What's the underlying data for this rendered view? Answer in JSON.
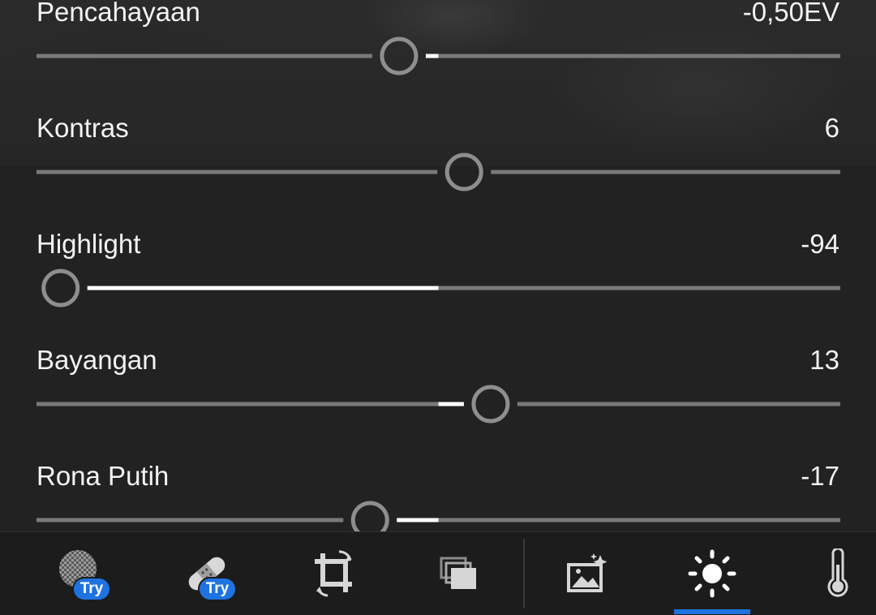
{
  "sliders": [
    {
      "label": "Pencahayaan",
      "value": "-0,50EV",
      "position": 0.451,
      "center": 0.5
    },
    {
      "label": "Kontras",
      "value": "6",
      "position": 0.532,
      "center": 0.5
    },
    {
      "label": "Highlight",
      "value": "-94",
      "position": 0.03,
      "center": 0.5
    },
    {
      "label": "Bayangan",
      "value": "13",
      "position": 0.565,
      "center": 0.5
    },
    {
      "label": "Rona Putih",
      "value": "-17",
      "position": 0.415,
      "center": 0.5
    }
  ],
  "toolbar": {
    "tools": [
      {
        "icon": "healing-icon",
        "badge": "Try",
        "active": false
      },
      {
        "icon": "bandage-icon",
        "badge": "Try",
        "active": false
      },
      {
        "icon": "crop-rotate-icon",
        "badge": "",
        "active": false
      },
      {
        "icon": "layers-icon",
        "badge": "",
        "active": false
      },
      {
        "icon": "auto-enhance-icon",
        "badge": "",
        "active": false
      },
      {
        "icon": "light-sun-icon",
        "badge": "",
        "active": true
      },
      {
        "icon": "thermometer-icon",
        "badge": "",
        "active": false
      }
    ]
  },
  "colors": {
    "accent": "#1f73e0",
    "track": "#7a7a7a",
    "fill": "#ffffff",
    "knob": "#8e8e8e"
  }
}
